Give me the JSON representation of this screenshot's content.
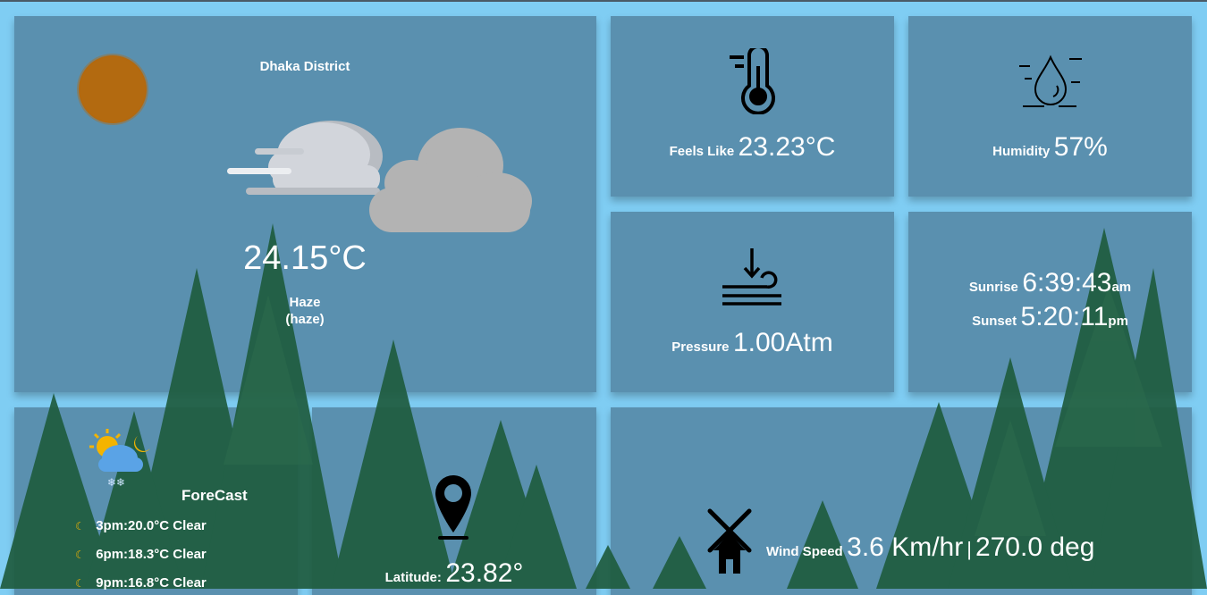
{
  "main": {
    "location": "Dhaka District",
    "temperature": "24.15°C",
    "condition": "Haze",
    "condition_detail": "(haze)"
  },
  "feels_like": {
    "label": "Feels Like",
    "value": "23.23°C"
  },
  "humidity": {
    "label": "Humidity",
    "value": "57%"
  },
  "pressure": {
    "label": "Pressure",
    "value": "1.00Atm"
  },
  "sun": {
    "sunrise_label": "Sunrise",
    "sunrise_time": "6:39:43",
    "sunrise_suffix": "am",
    "sunset_label": "Sunset",
    "sunset_time": "5:20:11",
    "sunset_suffix": "pm"
  },
  "forecast": {
    "title": "ForeCast",
    "items": [
      "3pm:20.0°C Clear",
      "6pm:18.3°C Clear",
      "9pm:16.8°C Clear"
    ]
  },
  "location": {
    "latitude_label": "Latitude:",
    "latitude_value": "23.82°"
  },
  "wind": {
    "label": "Wind Speed",
    "speed": "3.6 Km/hr",
    "separator": "|",
    "direction": "270.0 deg"
  },
  "icons": {
    "sun": "sun-icon",
    "clouds": "cloud-icon",
    "thermometer": "thermometer-icon",
    "humidity": "water-drop-icon",
    "pressure": "pressure-icon",
    "forecast": "weather-forecast-icon",
    "moon": "moon-icon",
    "location": "map-pin-icon",
    "wind": "windmill-icon"
  },
  "colors": {
    "background": "#7fcdf3",
    "card": "#5a8fae",
    "tree": "#1f5c3f",
    "sun": "#b36a10"
  }
}
